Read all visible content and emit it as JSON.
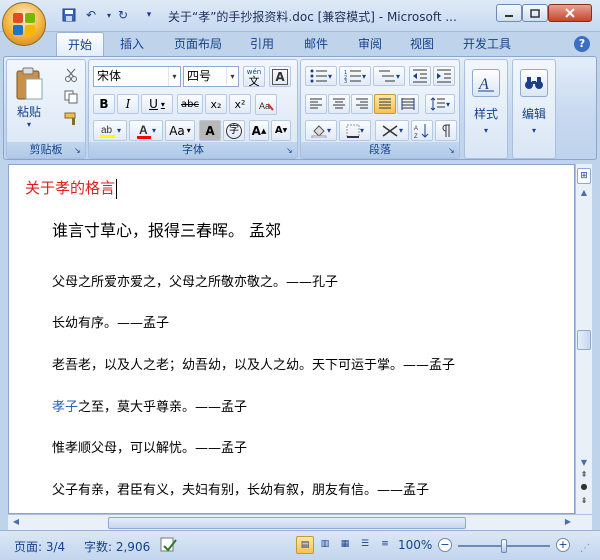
{
  "window": {
    "title": "关于“孝”的手抄报资料.doc [兼容模式] - Microsoft ..."
  },
  "ribbon_tabs": [
    {
      "label": "开始",
      "active": true
    },
    {
      "label": "插入"
    },
    {
      "label": "页面布局"
    },
    {
      "label": "引用"
    },
    {
      "label": "邮件"
    },
    {
      "label": "审阅"
    },
    {
      "label": "视图"
    },
    {
      "label": "开发工具"
    }
  ],
  "clipboard": {
    "paste_label": "粘贴",
    "group_label": "剪贴板"
  },
  "font": {
    "font_name": "宋体",
    "font_size": "四号",
    "wen_label": "wén",
    "wen_char": "文",
    "A_label": "A",
    "bold": "B",
    "italic": "I",
    "underline": "U",
    "strike": "abc",
    "sub": "x₂",
    "sup": "x²",
    "aa": "Aa",
    "char_shade": "A",
    "encircle": "字",
    "grow": "A",
    "shrink": "A",
    "group_label": "字体"
  },
  "paragraph": {
    "group_label": "段落"
  },
  "styles": {
    "label": "样式"
  },
  "editing": {
    "label": "编辑"
  },
  "document": {
    "heading": "关于孝的格言",
    "lines": [
      {
        "text": "谁言寸草心，报得三春晖。      孟郊",
        "large": true
      },
      {
        "text": "父母之所爱亦爱之，父母之所敬亦敬之。——孔子"
      },
      {
        "text": "长幼有序。——孟子"
      },
      {
        "text": "老吾老，以及人之老；幼吾幼，以及人之幼。天下可运于掌。——孟子"
      },
      {
        "link": "孝子",
        "rest": "之至，莫大乎尊亲。——孟子"
      },
      {
        "text": "惟孝顺父母，可以解忧。——孟子"
      },
      {
        "text": "父子有亲，君臣有义，夫妇有别，长幼有叙，朋友有信。——孟子"
      }
    ]
  },
  "status": {
    "page": "页面: 3/4",
    "words": "字数: 2,906",
    "zoom": "100%",
    "zoom_fraction": 0.5
  },
  "colors": {
    "heading_red": "#e02020",
    "link_blue": "#2a63b3",
    "highlight_yellow": "#ffff00",
    "font_color_red": "#ff0000"
  }
}
